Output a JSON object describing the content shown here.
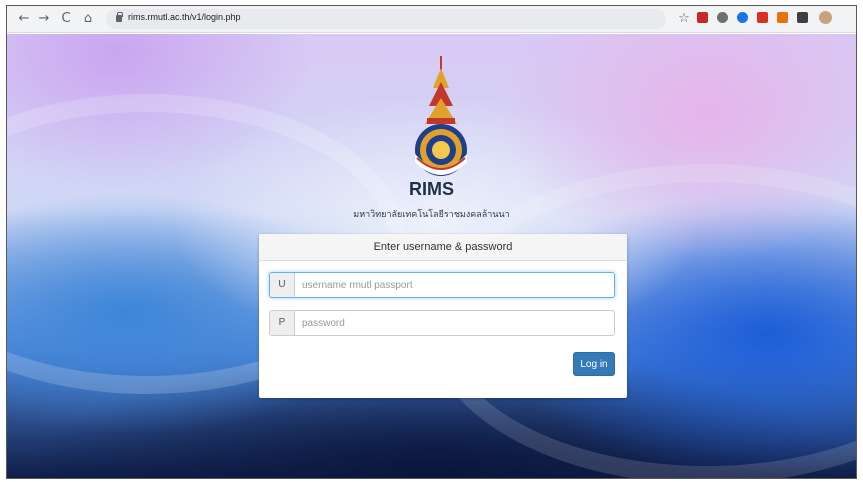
{
  "browser": {
    "back_icon": "←",
    "forward_icon": "→",
    "reload_icon": "C",
    "home_icon": "⌂",
    "url": "rims.rmutl.ac.th/v1/login.php",
    "bookmark_icon": "☆",
    "extensions": [
      {
        "name": "pdf-extension-icon",
        "color": "#c62828"
      },
      {
        "name": "camera-extension-icon",
        "color": "#6f6f6f"
      },
      {
        "name": "blue-extension-icon",
        "color": "#1a73e8"
      },
      {
        "name": "red-extension-icon",
        "color": "#d93025"
      },
      {
        "name": "download-extension-icon",
        "color": "#e8710a"
      },
      {
        "name": "puzzle-extension-icon",
        "color": "#3c4043"
      }
    ]
  },
  "brand": {
    "name": "RIMS",
    "university": "มหาวิทยาลัยเทคโนโลยีราชมงคลล้านนา"
  },
  "login": {
    "heading": "Enter username & password",
    "username": {
      "addon": "U",
      "placeholder": "username rmutl passport",
      "value": ""
    },
    "password": {
      "addon": "P",
      "placeholder": "password",
      "value": ""
    },
    "submit_label": "Log in"
  },
  "colors": {
    "primary_button": "#337ab7",
    "logo_gold": "#e0a22a",
    "logo_red": "#c0392b"
  }
}
